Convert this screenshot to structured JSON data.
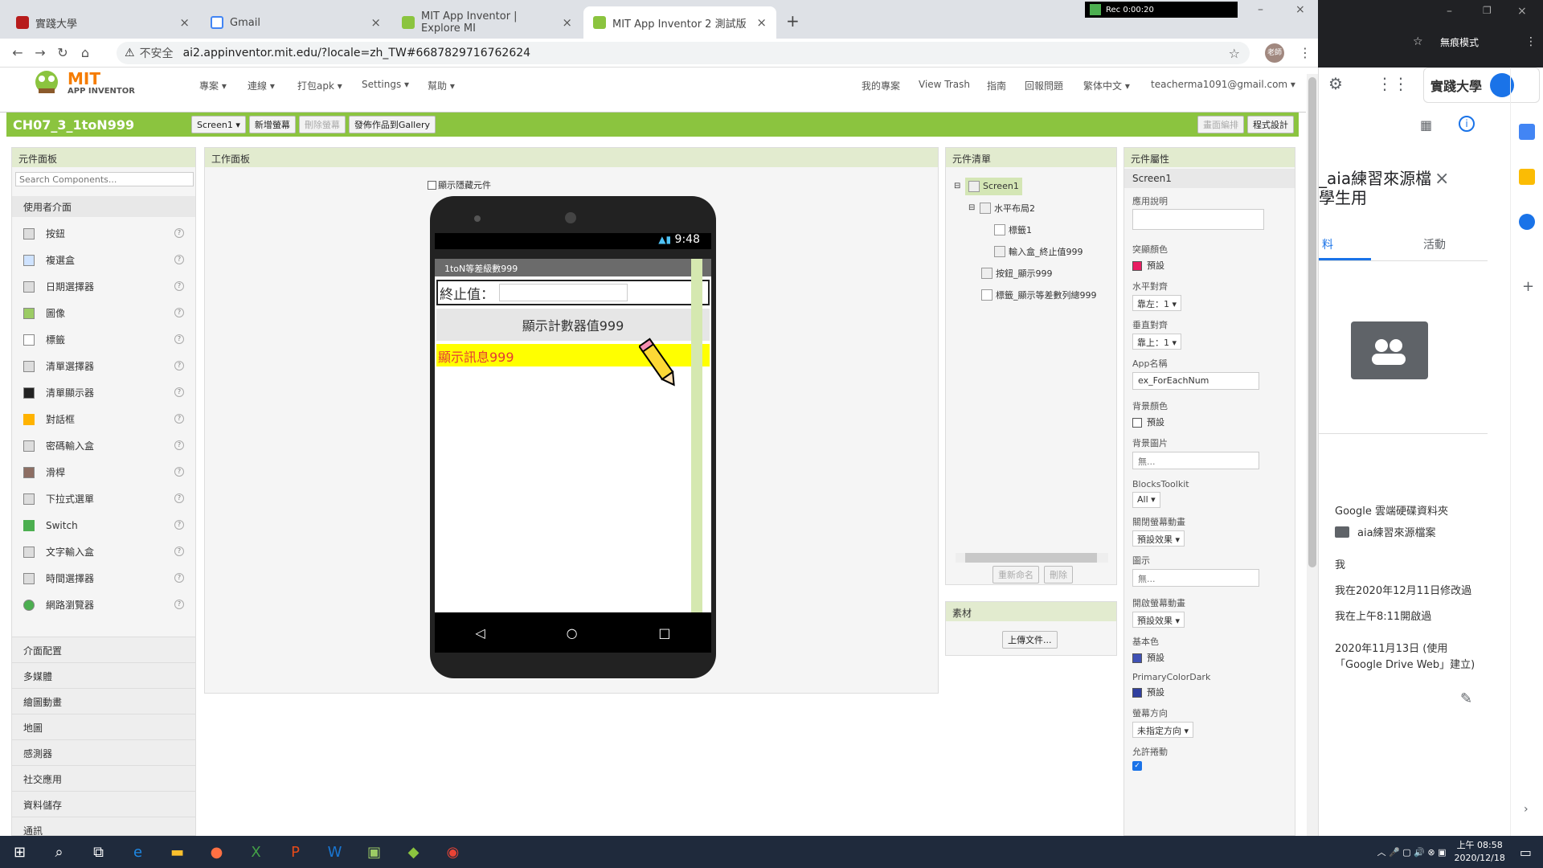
{
  "browser": {
    "tabs": [
      {
        "title": "實踐大學",
        "color": "#b71c1c"
      },
      {
        "title": "Gmail",
        "color": "#4285f4"
      },
      {
        "title": "MIT App Inventor | Explore MI",
        "color": "#8bc43f"
      },
      {
        "title": "MIT App Inventor 2 測試版",
        "color": "#8bc43f"
      }
    ],
    "rec_label": "Rec 0:00:20",
    "insecure": "不安全",
    "url": "ai2.appinventor.mit.edu/?locale=zh_TW#6687829716762624",
    "avatar_text": "老師",
    "incognito": "無痕模式"
  },
  "ai": {
    "logo_big": "MIT",
    "logo_small": "APP INVENTOR",
    "menu_left": [
      "專案 ▾",
      "連線 ▾",
      "打包apk ▾",
      "Settings ▾",
      "幫助 ▾"
    ],
    "menu_right": [
      "我的專案",
      "View Trash",
      "指南",
      "回報問題",
      "繁体中文 ▾",
      "teacherma1091@gmail.com ▾"
    ],
    "project_name": "CH07_3_1toN999",
    "screen_select": "Screen1 ▾",
    "btn_add_screen": "新增螢幕",
    "btn_remove_screen": "刪除螢幕",
    "btn_gallery": "發佈作品到Gallery",
    "btn_designer": "畫面編排",
    "btn_blocks": "程式設計"
  },
  "palette": {
    "title": "元件面板",
    "search_placeholder": "Search Components...",
    "section": "使用者介面",
    "items": [
      "按鈕",
      "複選盒",
      "日期選擇器",
      "圖像",
      "標籤",
      "清單選擇器",
      "清單顯示器",
      "對話框",
      "密碼輸入盒",
      "滑桿",
      "下拉式選單",
      "Switch",
      "文字輸入盒",
      "時間選擇器",
      "網路瀏覽器"
    ],
    "categories": [
      "介面配置",
      "多媒體",
      "繪圖動畫",
      "地圖",
      "感測器",
      "社交應用",
      "資料儲存",
      "通訊"
    ]
  },
  "viewer": {
    "title": "工作面板",
    "hidden_checkbox": "顯示隱藏元件",
    "status_time": "9:48",
    "app_title": "1toN等差級數999",
    "label_end": "終止值：",
    "button_text": "顯示計數器值999",
    "message_text": "顯示訊息999"
  },
  "tree": {
    "title": "元件清單",
    "nodes": [
      "Screen1",
      "水平布局2",
      "標籤1",
      "輸入盒_終止值999",
      "按鈕_顯示999",
      "標籤_顯示等差數列總999"
    ],
    "rename": "重新命名",
    "delete": "刪除",
    "media_title": "素材",
    "upload": "上傳文件..."
  },
  "props": {
    "title": "元件屬性",
    "component": "Screen1",
    "about_label": "應用說明",
    "accent_label": "突顯顏色",
    "accent_value": "預設",
    "halign_label": "水平對齊",
    "halign_value": "靠左：1 ▾",
    "valign_label": "垂直對齊",
    "valign_value": "靠上：1 ▾",
    "appname_label": "App名稱",
    "appname_value": "ex_ForEachNum",
    "bgcolor_label": "背景顏色",
    "bgcolor_value": "預設",
    "bgimage_label": "背景圖片",
    "bgimage_value": "無...",
    "blocks_label": "BlocksToolkit",
    "blocks_value": "All ▾",
    "closeanim_label": "關閉螢幕動畫",
    "closeanim_value": "預設效果 ▾",
    "icon_label": "圖示",
    "icon_value": "無...",
    "openanim_label": "開啟螢幕動畫",
    "openanim_value": "預設效果 ▾",
    "primary_label": "基本色",
    "primary_value": "預設",
    "primarydark_label": "PrimaryColorDark",
    "primarydark_value": "預設",
    "orient_label": "螢幕方向",
    "orient_value": "未指定方向 ▾",
    "scroll_label": "允許捲動"
  },
  "sidepanel": {
    "school": "實踐大學",
    "title_line1": "_aia練習來源檔",
    "title_line2": "學生用",
    "tab_details": "料",
    "tab_activity": "活動",
    "location_label": "Google 雲端硬碟資料夾",
    "folder": "aia練習來源檔案",
    "owner": "我",
    "modified": "我在2020年12月11日修改過",
    "opened": "我在上午8:11開啟過",
    "created_line1": "2020年11月13日 (使用",
    "created_line2": "「Google Drive Web」建立)"
  },
  "taskbar": {
    "time": "上午 08:58",
    "date": "2020/12/18"
  },
  "colors": {
    "ai_green": "#8bc43f",
    "accent_swatch": "#e91e63",
    "primary_swatch": "#3f51b5",
    "primarydark_swatch": "#303f9f",
    "message_bg": "#ffff00",
    "message_fg": "#e53935"
  }
}
